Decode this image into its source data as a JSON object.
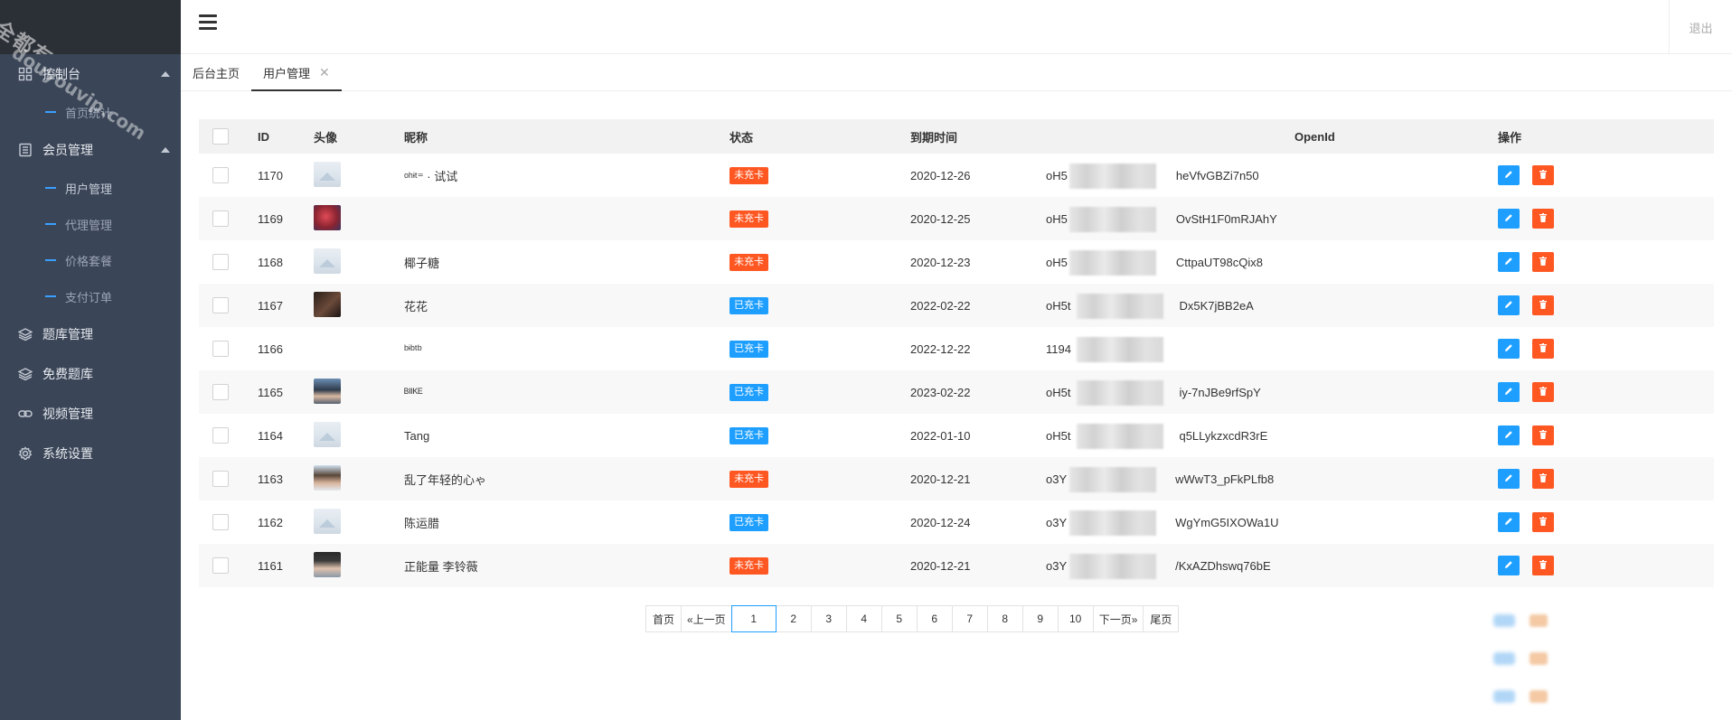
{
  "watermark": {
    "line1": "全都有综合资源网",
    "line2": "douyouvip.com"
  },
  "header": {
    "logout": "退出"
  },
  "sidebar": {
    "groups": [
      {
        "label": "控制台",
        "icon": "grid-icon",
        "expanded": true,
        "children": [
          {
            "label": "首页统计"
          }
        ]
      },
      {
        "label": "会员管理",
        "icon": "list-icon",
        "expanded": true,
        "children": [
          {
            "label": "用户管理"
          },
          {
            "label": "代理管理"
          },
          {
            "label": "价格套餐"
          },
          {
            "label": "支付订单"
          }
        ]
      },
      {
        "label": "题库管理",
        "icon": "layers-icon"
      },
      {
        "label": "免费题库",
        "icon": "layers-icon"
      },
      {
        "label": "视频管理",
        "icon": "link-icon"
      },
      {
        "label": "系统设置",
        "icon": "gear-icon"
      }
    ]
  },
  "tabs": [
    {
      "label": "后台主页"
    },
    {
      "label": "用户管理",
      "closable": true
    }
  ],
  "table": {
    "headers": {
      "id": "ID",
      "avatar": "头像",
      "nickname": "昵称",
      "status": "状态",
      "expire": "到期时间",
      "openid": "OpenId",
      "actions": "操作"
    },
    "rows": [
      {
        "id": "1170",
        "avatar": "placeholder",
        "nickname": "ᵒʰᶤᵗ⁼ · 试试",
        "status": "未充卡",
        "paid": false,
        "expire": "2020-12-26",
        "openid_start": "oH5",
        "openid_end": "heVfvGBZi7n50"
      },
      {
        "id": "1169",
        "avatar": "red",
        "nickname": "",
        "status": "未充卡",
        "paid": false,
        "expire": "2020-12-25",
        "openid_start": "oH5",
        "openid_end": "OvStH1F0mRJAhY"
      },
      {
        "id": "1168",
        "avatar": "placeholder",
        "nickname": "椰子糖",
        "status": "未充卡",
        "paid": false,
        "expire": "2020-12-23",
        "openid_start": "oH5",
        "openid_end": "CttpaUT98cQix8"
      },
      {
        "id": "1167",
        "avatar": "dark",
        "nickname": "花花",
        "status": "已充卡",
        "paid": true,
        "expire": "2022-02-22",
        "openid_start": "oH5t",
        "openid_end": "Dx5K7jBB2eA"
      },
      {
        "id": "1166",
        "avatar": "none",
        "nickname": "ᵇᶤᵇᵗᵇ",
        "status": "已充卡",
        "paid": true,
        "expire": "2022-12-22",
        "openid_start": "1194",
        "openid_end": ""
      },
      {
        "id": "1165",
        "avatar": "person",
        "nickname": "ᴮᴵᴵᴷᴱ",
        "status": "已充卡",
        "paid": true,
        "expire": "2023-02-22",
        "openid_start": "oH5t",
        "openid_end": "iy-7nJBe9rfSpY"
      },
      {
        "id": "1164",
        "avatar": "placeholder",
        "nickname": "Tang",
        "status": "已充卡",
        "paid": true,
        "expire": "2022-01-10",
        "openid_start": "oH5t",
        "openid_end": "q5LLykzxcdR3rE"
      },
      {
        "id": "1163",
        "avatar": "person2",
        "nickname": "乱了年轻的心ゃ",
        "status": "未充卡",
        "paid": false,
        "expire": "2020-12-21",
        "openid_start": "o3Y",
        "openid_end": "wWwT3_pFkPLfb8"
      },
      {
        "id": "1162",
        "avatar": "placeholder",
        "nickname": "陈运腊",
        "status": "已充卡",
        "paid": true,
        "expire": "2020-12-24",
        "openid_start": "o3Y",
        "openid_end": "WgYmG5IXOWa1U"
      },
      {
        "id": "1161",
        "avatar": "person3",
        "nickname": "正能量 李铃薇",
        "status": "未充卡",
        "paid": false,
        "expire": "2020-12-21",
        "openid_start": "o3Y",
        "openid_end": "/KxAZDhswq76bE"
      }
    ]
  },
  "pagination": {
    "first": "首页",
    "prev": "«上一页",
    "pages": [
      "1",
      "2",
      "3",
      "4",
      "5",
      "6",
      "7",
      "8",
      "9",
      "10"
    ],
    "current": "1",
    "next": "下一页»",
    "last": "尾页"
  },
  "colors": {
    "sidebar": "#3a4557",
    "logo_bg": "#2b2f36",
    "accent_blue": "#1e9fff",
    "accent_orange": "#ff5722"
  }
}
